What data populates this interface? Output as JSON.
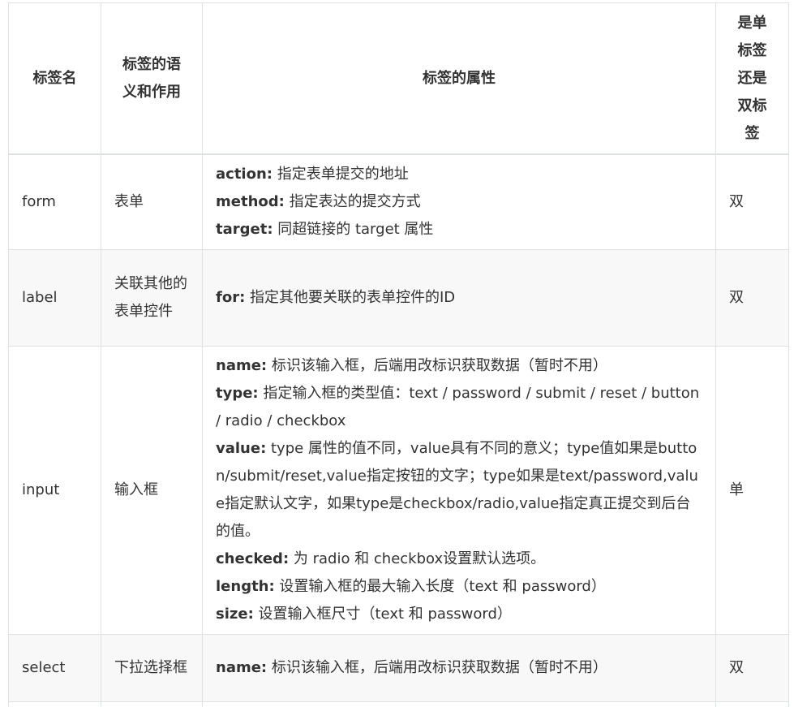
{
  "headers": {
    "name": "标签名",
    "semantics": "标签的语义和作用",
    "attributes": "标签的属性",
    "single_or_double": "是单标签还是双标签"
  },
  "rows": [
    {
      "name": "form",
      "semantics": "表单",
      "attributes": [
        {
          "key": "action:",
          "text": " 指定表单提交的地址"
        },
        {
          "key": "method:",
          "text": " 指定表达的提交方式"
        },
        {
          "key": "target:",
          "text": " 同超链接的 target 属性"
        }
      ],
      "type": "双"
    },
    {
      "name": "label",
      "semantics": "关联其他的表单控件",
      "attributes": [
        {
          "key": "for:",
          "text": " 指定其他要关联的表单控件的ID"
        }
      ],
      "type": "双"
    },
    {
      "name": "input",
      "semantics": "输入框",
      "attributes": [
        {
          "key": "name:",
          "text": " 标识该输入框，后端用改标识获取数据（暂时不用）"
        },
        {
          "key": "type:",
          "text": " 指定输入框的类型值：text / password / submit / reset / button / radio / checkbox"
        },
        {
          "key": "value:",
          "text": " type 属性的值不同，value具有不同的意义；type值如果是button/submit/reset,value指定按钮的文字；type如果是text/password,value指定默认文字，如果type是checkbox/radio,value指定真正提交到后台的值。"
        },
        {
          "key": "checked:",
          "text": " 为 radio 和 checkbox设置默认选项。"
        },
        {
          "key": "length:",
          "text": " 设置输入框的最大输入长度（text 和 password）"
        },
        {
          "key": "size:",
          "text": "  设置输入框尺寸（text 和 password）"
        }
      ],
      "type": "单"
    },
    {
      "name": "select",
      "semantics": "下拉选择框",
      "attributes": [
        {
          "key": "name:",
          "text": " 标识该输入框，后端用改标识获取数据（暂时不用）"
        }
      ],
      "type": "双"
    }
  ]
}
